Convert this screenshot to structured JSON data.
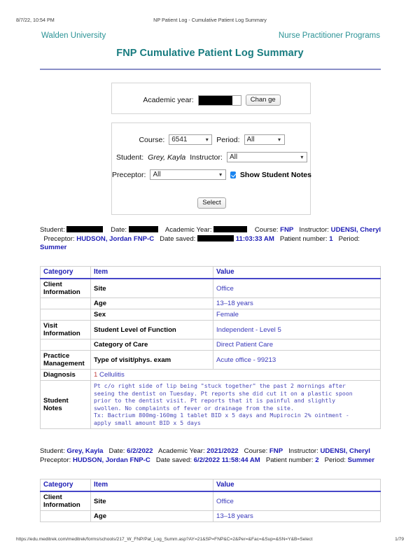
{
  "browser_print_header": {
    "timestamp": "8/7/22, 10:54 PM",
    "document_title": "NP Patient Log - Cumulative Patient Log Summary"
  },
  "branding": {
    "left": "Walden University",
    "right": "Nurse Practitioner Programs",
    "teal": "#2b9396",
    "title_teal": "#177b7f",
    "rule_color": "#8a8fc7"
  },
  "page_title": "FNP Cumulative Patient Log Summary",
  "academic_year_panel": {
    "label": "Academic year:",
    "value": "",
    "redacted": true,
    "change_button": "Chan ge"
  },
  "filter_panel": {
    "course_label": "Course:",
    "course_value": "6541",
    "period_label": "Period:",
    "period_value": "All",
    "student_label": "Student:",
    "student_value": "Grey, Kayla",
    "instructor_label": "Instructor:",
    "instructor_value": "All",
    "preceptor_label": "Preceptor:",
    "preceptor_value": "All",
    "show_student_notes_label": "Show Student Notes",
    "show_student_notes_checked": true,
    "select_button": "Select",
    "checkbox_color": "#1a84f0"
  },
  "records": [
    {
      "meta": {
        "student_label": "Student:",
        "student_value": "",
        "student_redacted": true,
        "date_label": "Date:",
        "date_value": "",
        "date_redacted": true,
        "academic_year_label": "Academic Year:",
        "academic_year_value": "",
        "academic_year_redacted": true,
        "course_label": "Course:",
        "course_value": "FNP",
        "instructor_label": "Instructor:",
        "instructor_value": "UDENSI, Cheryl",
        "preceptor_label": "Preceptor:",
        "preceptor_value": "HUDSON, Jordan FNP-C",
        "date_saved_label": "Date saved:",
        "date_saved_value": "11:03:33 AM",
        "date_saved_redacted": true,
        "patient_number_label": "Patient number:",
        "patient_number_value": "1",
        "period_label": "Period:",
        "period_value": "Summer"
      },
      "table": {
        "headers": [
          "Category",
          "Item",
          "Value"
        ],
        "rows": [
          {
            "type": "normal",
            "category": "Client Information",
            "item": "Site",
            "value": "Office"
          },
          {
            "type": "normal",
            "category": "",
            "item": "Age",
            "value": "13–18 years"
          },
          {
            "type": "normal",
            "category": "",
            "item": "Sex",
            "value": "Female"
          },
          {
            "type": "normal",
            "category": "Visit Information",
            "item": "Student Level of Function",
            "value": "Independent - Level 5"
          },
          {
            "type": "normal",
            "category": "",
            "item": "Category of Care",
            "value": "Direct Patient Care"
          },
          {
            "type": "normal",
            "category": "Practice Management",
            "item": "Type of visit/phys. exam",
            "value": "Acute office - 99213"
          },
          {
            "type": "diagnosis",
            "category": "Diagnosis",
            "number": "1",
            "text": "Cellulitis"
          },
          {
            "type": "notes",
            "category": "Student Notes",
            "text": "Pt c/o right side of lip being \"stuck together\" the past 2 mornings after\nseeing the dentist on Tuesday. Pt reports she did cut it on a plastic spoon\nprior to the dentist visit. Pt reports that it is painful and slightly\nswollen. No complaints of fever or drainage from the site.\nTx: Bactrium 800mg-160mg 1 tablet BID x 5 days and Mupirocin 2% ointment -\napply small amount BID x 5 days"
          }
        ]
      }
    },
    {
      "meta": {
        "student_label": "Student:",
        "student_value": "Grey, Kayla",
        "student_redacted": false,
        "date_label": "Date:",
        "date_value": "6/2/2022",
        "date_redacted": false,
        "academic_year_label": "Academic Year:",
        "academic_year_value": "2021/2022",
        "academic_year_redacted": false,
        "course_label": "Course:",
        "course_value": "FNP",
        "instructor_label": "Instructor:",
        "instructor_value": "UDENSI, Cheryl",
        "preceptor_label": "Preceptor:",
        "preceptor_value": "HUDSON, Jordan FNP-C",
        "date_saved_label": "Date saved:",
        "date_saved_value": "6/2/2022 11:58:44 AM",
        "date_saved_redacted": false,
        "patient_number_label": "Patient number:",
        "patient_number_value": "2",
        "period_label": "Period:",
        "period_value": "Summer"
      },
      "table": {
        "headers": [
          "Category",
          "Item",
          "Value"
        ],
        "rows": [
          {
            "type": "normal",
            "category": "Client Information",
            "item": "Site",
            "value": "Office"
          },
          {
            "type": "normal",
            "category": "",
            "item": "Age",
            "value": "13–18 years"
          }
        ]
      }
    }
  ],
  "footer": {
    "url": "https://edu.meditrek.com/meditrek/forms/schools/217_W_FNP/Pat_Log_Summ.asp?AY=21&SP=FNP&C=2&Per=&Fac=&Sup=&SN=Y&B=Select",
    "page": "1/79"
  }
}
